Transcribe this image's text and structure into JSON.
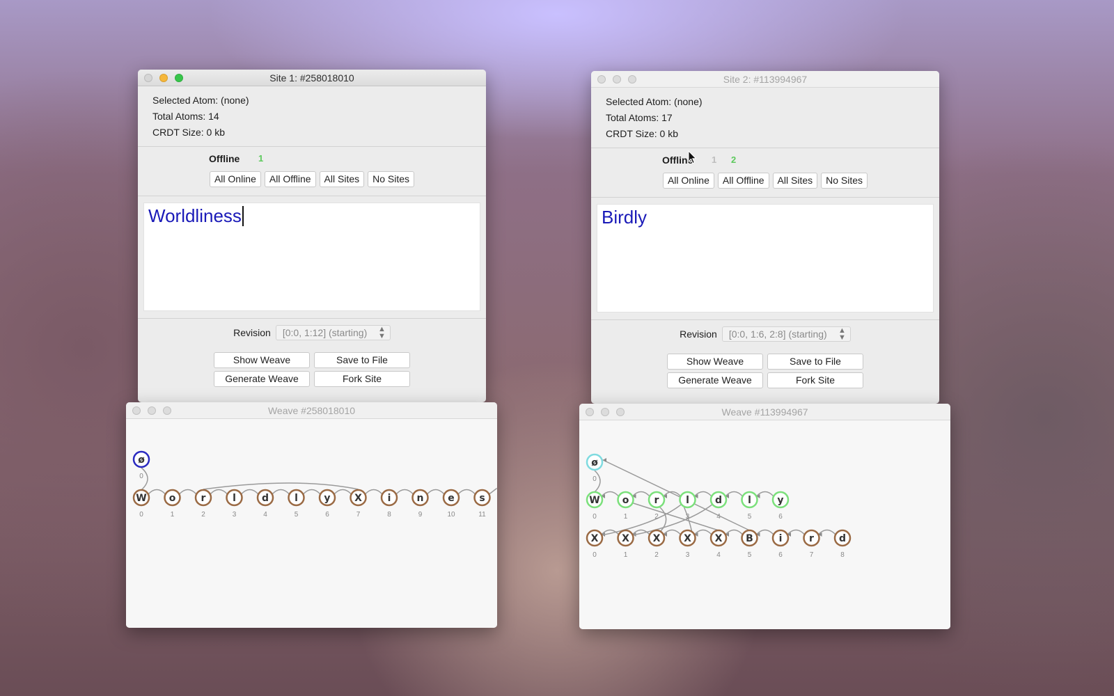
{
  "site1": {
    "title": "Site 1: #258018010",
    "selected_atom": "Selected Atom: (none)",
    "total_atoms": "Total Atoms: 14",
    "crdt_size": "CRDT Size: 0 kb",
    "status_label": "Offline",
    "site_numbers": [
      {
        "label": "1",
        "color": "#5cc95c"
      }
    ],
    "connection_buttons": [
      "All Online",
      "All Offline",
      "All Sites",
      "No Sites"
    ],
    "document_text": "Worldliness",
    "revision_label": "Revision",
    "revision_value": "[0:0, 1:12] (starting)",
    "actions": {
      "show_weave": "Show Weave",
      "save_to_file": "Save to File",
      "generate_weave": "Generate Weave",
      "fork_site": "Fork Site"
    }
  },
  "site2": {
    "title": "Site 2: #113994967",
    "selected_atom": "Selected Atom: (none)",
    "total_atoms": "Total Atoms: 17",
    "crdt_size": "CRDT Size: 0 kb",
    "status_label": "Offline",
    "site_numbers": [
      {
        "label": "1",
        "color": "#bdbdbd"
      },
      {
        "label": "2",
        "color": "#5cc95c"
      }
    ],
    "connection_buttons": [
      "All Online",
      "All Offline",
      "All Sites",
      "No Sites"
    ],
    "document_text": "Birdly",
    "revision_label": "Revision",
    "revision_value": "[0:0, 1:6, 2:8] (starting)",
    "actions": {
      "show_weave": "Show Weave",
      "save_to_file": "Save to File",
      "generate_weave": "Generate Weave",
      "fork_site": "Fork Site"
    }
  },
  "weave1": {
    "title": "Weave #258018010",
    "root": {
      "char": "ø",
      "index": "0",
      "color": "#2a2ac0"
    },
    "rows": [
      {
        "color": "#9a6a44",
        "atoms": [
          "W",
          "o",
          "r",
          "l",
          "d",
          "l",
          "y",
          "X",
          "i",
          "n",
          "e",
          "s"
        ],
        "indices": [
          "0",
          "1",
          "2",
          "3",
          "4",
          "5",
          "6",
          "7",
          "8",
          "9",
          "10",
          "11"
        ]
      }
    ]
  },
  "weave2": {
    "title": "Weave #113994967",
    "root": {
      "char": "ø",
      "index": "0",
      "color": "#7fdbe0"
    },
    "rows": [
      {
        "color": "#7be07b",
        "atoms": [
          "W",
          "o",
          "r",
          "l",
          "d",
          "l",
          "y"
        ],
        "indices": [
          "0",
          "1",
          "2",
          "3",
          "4",
          "5",
          "6"
        ]
      },
      {
        "color": "#9a6a44",
        "atoms": [
          "X",
          "X",
          "X",
          "X",
          "X",
          "B",
          "i",
          "r",
          "d"
        ],
        "indices": [
          "0",
          "1",
          "2",
          "3",
          "4",
          "5",
          "6",
          "7",
          "8"
        ]
      }
    ]
  },
  "colors": {
    "text_blue": "#1a1ab8",
    "online_green": "#5cc95c"
  }
}
